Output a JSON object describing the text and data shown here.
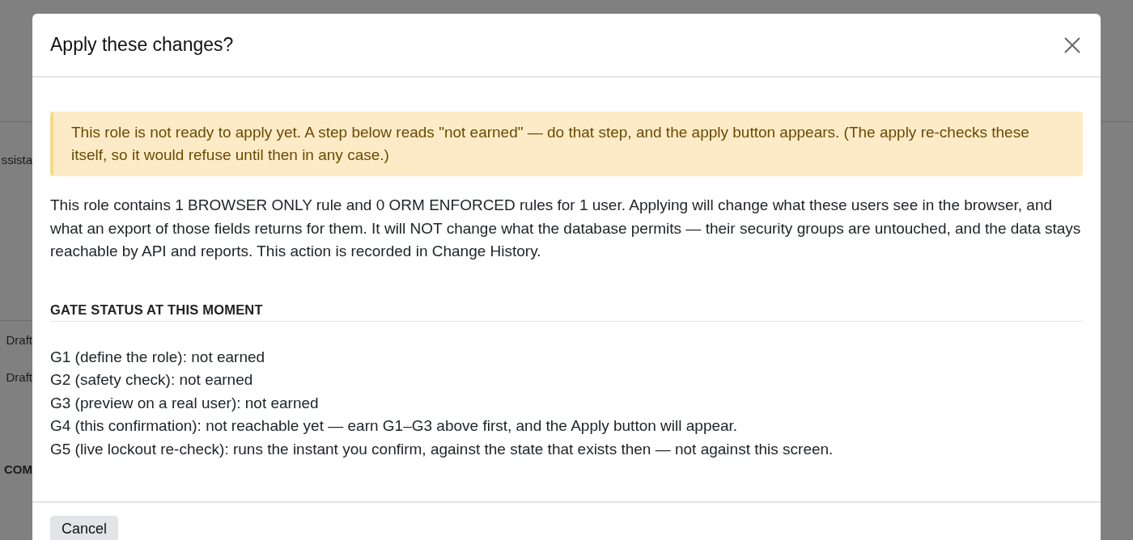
{
  "background": {
    "fragments": [
      {
        "text": "ssista",
        "kind": "text"
      },
      {
        "text": "Draft",
        "kind": "text"
      },
      {
        "text": "Draft",
        "kind": "text"
      },
      {
        "text": "COM",
        "kind": "heading"
      }
    ]
  },
  "dialog": {
    "title": "Apply these changes?",
    "warning": "This role is not ready to apply yet. A step below reads \"not earned\" — do that step, and the apply button appears. (The apply re-checks these itself, so it would refuse until then in any case.)",
    "description": "This role contains 1 BROWSER ONLY rule and 0 ORM ENFORCED rules for 1 user. Applying will change what these users see in the browser, and what an export of those fields returns for them. It will NOT change what the database permits — their security groups are untouched, and the data stays reachable by API and reports. This action is recorded in Change History.",
    "section_heading": "GATE STATUS AT THIS MOMENT",
    "gates": [
      "G1 (define the role): not earned",
      "G2 (safety check): not earned",
      "G3 (preview on a real user): not earned",
      "G4 (this confirmation): not reachable yet — earn G1–G3 above first, and the Apply button will appear.",
      "G5 (live lockout re-check): runs the instant you confirm, against the state that exists then — not against this screen."
    ],
    "buttons": [
      "Cancel"
    ]
  }
}
